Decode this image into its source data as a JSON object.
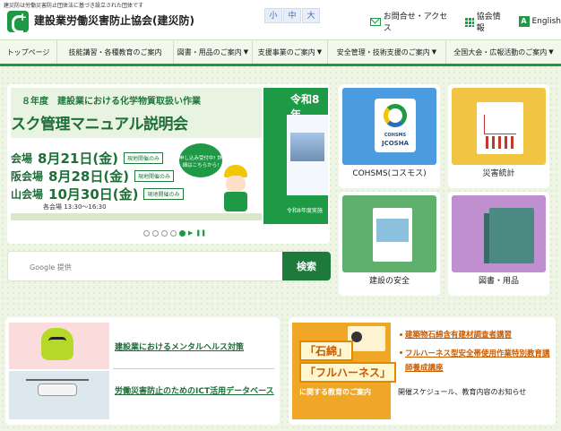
{
  "header": {
    "tagline": "建災防は労働災害防止団体法に基づき設立された団体です",
    "site_title": "建設業労働災害防止協会(建災防)",
    "font_sizes": [
      "小",
      "中",
      "大"
    ],
    "links": [
      {
        "label": "お問合せ・アクセス",
        "icon": "mail-icon"
      },
      {
        "label": "協会情報",
        "icon": "grid-icon"
      },
      {
        "label": "English",
        "icon": "a-icon",
        "icon_text": "A"
      }
    ]
  },
  "nav": {
    "items": [
      {
        "label": "トップページ",
        "dropdown": false
      },
      {
        "label": "技能講習・各種教育のご案内",
        "dropdown": false
      },
      {
        "label": "図書・用品のご案内",
        "dropdown": true
      },
      {
        "label": "支援事業のご案内",
        "dropdown": true
      },
      {
        "label": "安全管理・技術支援のご案内",
        "dropdown": true
      },
      {
        "label": "全国大会・広報活動のご案内",
        "dropdown": true
      }
    ]
  },
  "banner": {
    "subtitle": "８年度　建設業における化学物質取扱い作業",
    "title": "スク管理マニュアル説明会",
    "sessions": [
      {
        "venue": "会場",
        "date": "8月21日(金)",
        "tag": "現地開催のみ"
      },
      {
        "venue": "阪会場",
        "date": "8月28日(金)",
        "tag": "現地開催のみ"
      },
      {
        "venue": "山会場",
        "date": "10月30日(金)",
        "tag": "現地開催のみ"
      }
    ],
    "time": "各会場 13:30～16:30",
    "bubble": "申し込み受付中! 詳細はこちらから!",
    "right_heading": "令和8年",
    "right_footer": "令和8年度実施"
  },
  "slider": {
    "dot_count": 5,
    "active_index": 4,
    "arrow": "▶",
    "pause": "❚❚"
  },
  "search": {
    "placeholder": "Google 提供",
    "button_label": "検索"
  },
  "tiles": [
    {
      "label": "COHSMS(コスモス)",
      "logo_line1": "COHSMS",
      "logo_line2": "JCOSHA"
    },
    {
      "label": "災害統計"
    },
    {
      "label": "建設の安全"
    },
    {
      "label": "図書・用品"
    }
  ],
  "features": {
    "left": [
      {
        "label": "建設業におけるメンタルヘルス対策"
      },
      {
        "label": "労働災害防止のためのICT活用データベース"
      }
    ],
    "education": {
      "box1": "「石綿」",
      "box2": "「フルハーネス」",
      "caption": "に関する教育のご案内",
      "links": [
        "建築物石綿含有建材調査者講習",
        "フルハーネス型安全帯使用作業特別教育講師養成講座"
      ],
      "note": "開催スケジュール、教育内容のお知らせ"
    }
  },
  "colors": {
    "brand_green": "#1e9a46",
    "dark_green": "#1e7a3a",
    "orange": "#c85a00"
  }
}
